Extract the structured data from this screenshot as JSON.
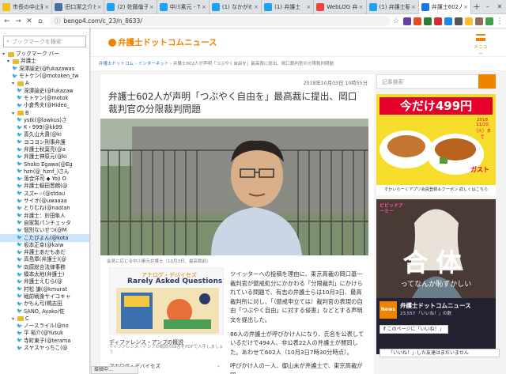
{
  "browser": {
    "tabs": [
      {
        "label": "市長の中止邪",
        "color": "#f4c20d"
      },
      {
        "label": "田口潔之介と保",
        "color": "#4a6fa5"
      },
      {
        "label": "(2) 佐藤倫子",
        "color": "#1da1f2"
      },
      {
        "label": "中川素元 - Tu",
        "color": "#1da1f2"
      },
      {
        "label": "(1) なかがわ",
        "color": "#1da1f2"
      },
      {
        "label": "(1) 弁護士",
        "color": "#1da1f2"
      },
      {
        "label": "WebLOG 弁護",
        "color": "#e8453c"
      },
      {
        "label": "(1) 弁護士稲",
        "color": "#1da1f2"
      },
      {
        "label": "弁護士602人",
        "color": "#1a73e8",
        "active": true
      }
    ],
    "url": "bengo4.com/c_23/n_8633/",
    "status": "接続中…"
  },
  "sidebar": {
    "search_placeholder": "ブックマークを検索",
    "items": [
      {
        "label": "ブックマーク バー",
        "type": "folder",
        "level": 0
      },
      {
        "label": "弁護士",
        "type": "folder",
        "level": 1
      },
      {
        "label": "深澤諭史(@fukazawas",
        "type": "tw",
        "level": 2
      },
      {
        "label": "モトケン(@motoken_tw",
        "type": "tw",
        "level": 2
      },
      {
        "label": "A",
        "type": "folder",
        "level": 2
      },
      {
        "label": "深澤諭史(@fukazaw",
        "type": "tw",
        "level": 3
      },
      {
        "label": "モトケン(@motok",
        "type": "tw",
        "level": 3
      },
      {
        "label": "小倉秀夫(@Hideo_",
        "type": "tw",
        "level": 3
      },
      {
        "label": "B",
        "type": "folder",
        "level": 2
      },
      {
        "label": "ystk(@lawkus)さ",
        "type": "tw",
        "level": 3
      },
      {
        "label": "K・999(@kk99",
        "type": "tw",
        "level": 3
      },
      {
        "label": "喜久山大貴(@ki",
        "type": "tw",
        "level": 3
      },
      {
        "label": "ヨコヨン刑事弁護",
        "type": "tw",
        "level": 3
      },
      {
        "label": "弁護士秋葉亮(@a",
        "type": "tw",
        "level": 3
      },
      {
        "label": "弁護士神原元(@ki",
        "type": "tw",
        "level": 3
      },
      {
        "label": "Shoko Egawa(@Eg",
        "type": "tw",
        "level": 3
      },
      {
        "label": "hzn(@_hznf_)さん",
        "type": "tw",
        "level": 3
      },
      {
        "label": "落合洋司 ◆ Yoji O",
        "type": "tw",
        "level": 3
      },
      {
        "label": "弁護士稲田晋朗(@",
        "type": "tw",
        "level": 3
      },
      {
        "label": "スズ←☆(@stdau",
        "type": "tw",
        "level": 3
      },
      {
        "label": "サイオ(@uwaaaa",
        "type": "tw",
        "level": 3
      },
      {
        "label": "とりむね(@naotan",
        "type": "tw",
        "level": 3
      },
      {
        "label": "弁護士：鈴田隼人",
        "type": "tw",
        "level": 3
      },
      {
        "label": "自家製パンチェッタ",
        "type": "tw",
        "level": 3
      },
      {
        "label": "個別ないせつ(@M",
        "type": "tw",
        "level": 3
      },
      {
        "label": "こたぴよん(@kota",
        "type": "tw",
        "level": 3,
        "selected": true
      },
      {
        "label": "坂本正幸(@kaiw",
        "type": "tw",
        "level": 3
      },
      {
        "label": "弁護士あだもあだ",
        "type": "tw",
        "level": 3
      },
      {
        "label": "高島章(弁護士)(@",
        "type": "tw",
        "level": 3
      },
      {
        "label": "向原総合法律事務",
        "type": "tw",
        "level": 3
      },
      {
        "label": "橋本太地(弁護士)",
        "type": "tw",
        "level": 3
      },
      {
        "label": "弁護士えむら(@",
        "type": "tw",
        "level": 3
      },
      {
        "label": "村松 謙(@kmurat",
        "type": "tw",
        "level": 3
      },
      {
        "label": "戦前戦後サイコキャ",
        "type": "tw",
        "level": 3
      },
      {
        "label": "かもん弓(鴨志田",
        "type": "tw",
        "level": 3
      },
      {
        "label": "SANO, Ayako/佐",
        "type": "tw",
        "level": 3
      },
      {
        "label": "C",
        "type": "folder",
        "level": 2
      },
      {
        "label": "ノースライル(@no",
        "type": "tw",
        "level": 3
      },
      {
        "label": "平 裕介(@Yusuk",
        "type": "tw",
        "level": 3
      },
      {
        "label": "寺町東子(@terama",
        "type": "tw",
        "level": 3
      },
      {
        "label": "スヤスヤっちこ(@",
        "type": "tw",
        "level": 3
      }
    ]
  },
  "site": {
    "logo": "弁護士ドットコムニュース",
    "menu_label": "メニュー",
    "breadcrumb": [
      "弁護士ドットコム",
      "インターネット",
      "弁護士602人が声明「つぶやく自由を」最高裁に提出、岡口裁判官の分限裁判問題"
    ],
    "search_placeholder": "記事検索"
  },
  "article": {
    "date": "2018年10月03日 10時55分",
    "title": "弁護士602人が声明「つぶやく自由を」最高裁に提出、岡口裁判官の分限裁判問題",
    "caption": "会見に応じる中川素元弁護士（10月3日、最高裁前）",
    "paragraphs": [
      "ツイッターへの投稿を理由に、東京高裁の岡口基一裁判官が懲戒処分にかかわる「分限裁判」にかけられている問題で、有志の弁護士らは10月3日、最高裁判所に対し、「（懲戒申立ては）裁判官の表現の自由「つぶやく自由」に対する侵害」などとする声明文を提出した。",
      "86人の弁護士が呼びかけ人になり、氏名を公表しているだけで494人、非公表22人の弁護士が賛同した。あわせて602人（10月3日7時30分時点）。",
      "呼びかけ人の一人、御山未が弁護士で、東京高裁が岡"
    ]
  },
  "ad_left": {
    "header": "アナログ・デバイセズ",
    "headline": "Rarely Asked Questions",
    "title": "ディファレンス・アンプの概説",
    "snippet": "ディファレンス・アンプの概説の回答をPDFで入手しましょう",
    "brand": "アナログ・デバイセズ"
  },
  "ad_right_1": {
    "big": "今だけ499円",
    "sub": "2018 11/20（火）まで",
    "brand": "ガスト",
    "foot": "すかいらーくアプリ会員登録＆クーポン 詳しくはこちら"
  },
  "ad_right_2": {
    "small": "ビビッドアーミー",
    "big": "合体",
    "sub": "ってなんか恥ずかしい"
  },
  "fb_widget": {
    "name": "弁護士ドットコムニュース",
    "likes": "23,557 「いいね！」の数",
    "button": "このページに「いいね！」"
  },
  "notif": "「いいね！」した友達はまだいません",
  "colors": {
    "brand": "#f08300",
    "accent": "#1a73e8",
    "twitter": "#1da1f2"
  }
}
